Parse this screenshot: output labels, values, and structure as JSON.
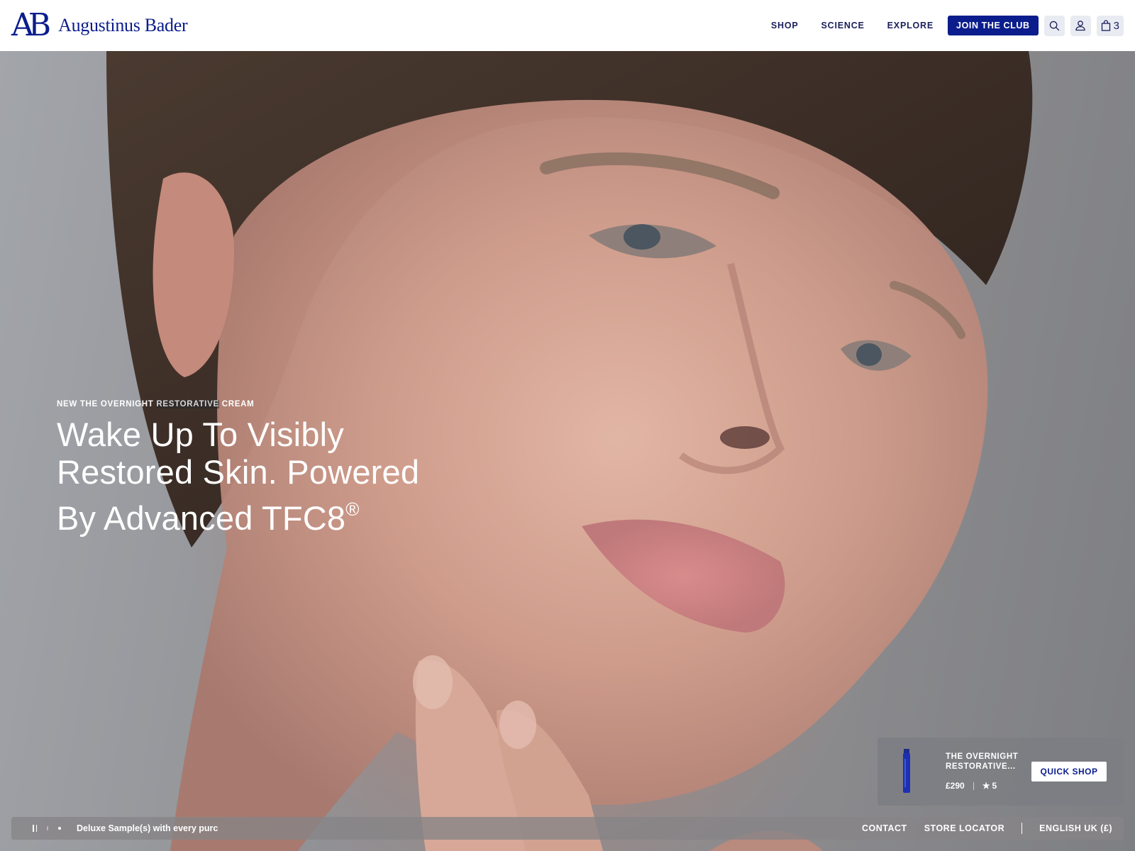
{
  "brand": {
    "monogram": "AB",
    "name": "Augustinus Bader",
    "accent_color": "#0b1d8c"
  },
  "nav": {
    "links": [
      "SHOP",
      "SCIENCE",
      "EXPLORE"
    ],
    "cta": "JOIN THE CLUB",
    "icons": [
      "search-icon",
      "account-icon",
      "bag-icon"
    ],
    "cart_count": "3"
  },
  "hero": {
    "eyebrow_pre": "NEW THE OVERNIGHT ",
    "eyebrow_highlight": "RESTORATIVE",
    "eyebrow_post": " CREAM",
    "headline": "Wake Up To Visibly Restored Skin. Powered By Advanced TFC8",
    "headline_mark": "®"
  },
  "product_card": {
    "name": "THE OVERNIGHT RESTORATIVE...",
    "price": "£290",
    "rating": "5",
    "button": "QUICK SHOP"
  },
  "bottom_bar": {
    "ticker": "Deluxe Sample(s) with every purc",
    "links": [
      "CONTACT",
      "STORE LOCATOR"
    ],
    "locale": "ENGLISH UK (£)"
  }
}
